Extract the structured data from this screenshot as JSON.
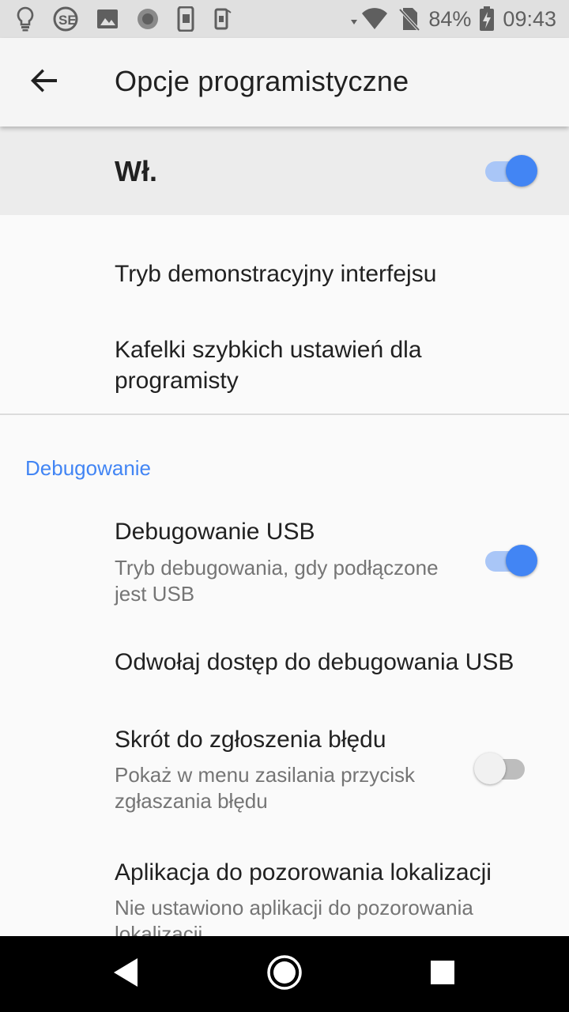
{
  "status_bar": {
    "battery_percent": "84%",
    "time": "09:43",
    "notification_icons": [
      "lightbulb-icon",
      "se-app-icon",
      "image-icon",
      "circle-record-icon",
      "phone-portrait-icon",
      "phone-rotate-icon"
    ],
    "system_icons": [
      "wifi-icon",
      "no-sim-icon",
      "battery-charging-icon"
    ]
  },
  "app_bar": {
    "title": "Opcje programistyczne"
  },
  "master_switch": {
    "label": "Wł.",
    "checked": true
  },
  "items_before_divider": [
    {
      "title": "Tryb demonstracyjny interfejsu"
    },
    {
      "title": "Kafelki szybkich ustawień dla programisty"
    }
  ],
  "debugging": {
    "category_title": "Debugowanie",
    "items": [
      {
        "title": "Debugowanie USB",
        "summary": "Tryb debugowania, gdy podłączone jest USB",
        "checked": true
      },
      {
        "title": "Odwołaj dostęp do debugowania USB"
      },
      {
        "title": "Skrót do zgłoszenia błędu",
        "summary": "Pokaż w menu zasilania przycisk zgłaszania błędu",
        "checked": false
      },
      {
        "title": "Aplikacja do pozorowania lokalizacji",
        "summary": "Nie ustawiono aplikacji do pozorowania lokalizacji"
      }
    ]
  },
  "colors": {
    "accent": "#4285f4",
    "accent_track": "#a9c6f7",
    "status_bar_bg": "#e0e0e0",
    "app_bar_bg": "#f5f5f5",
    "master_bar_bg": "#ececec",
    "list_bg": "#fafafa",
    "nav_bar_bg": "#000000"
  },
  "nav_bar": {
    "buttons": [
      "back-triangle-icon",
      "home-circle-icon",
      "recents-square-icon"
    ]
  }
}
